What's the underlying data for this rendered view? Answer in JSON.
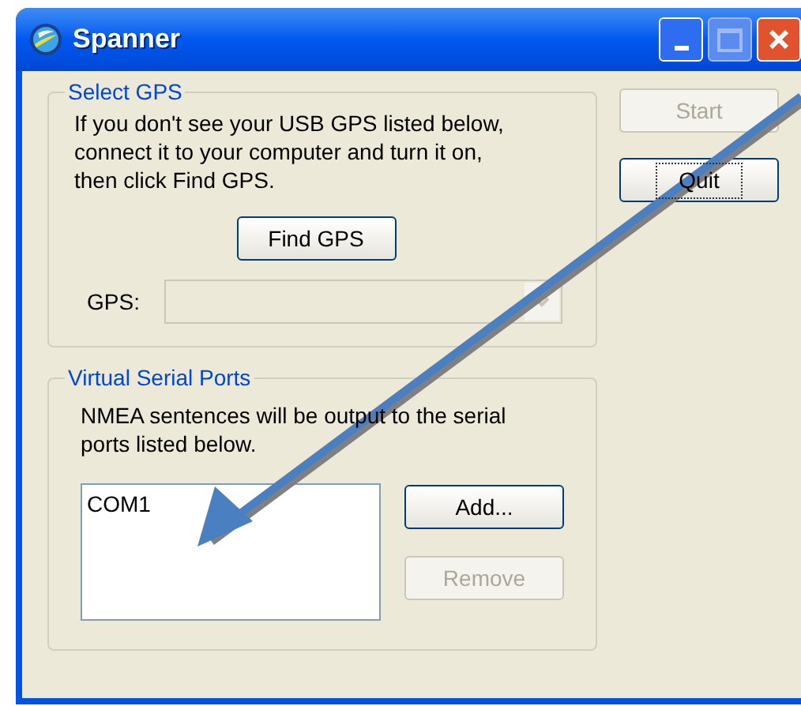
{
  "window": {
    "title": "Spanner"
  },
  "select_gps": {
    "title": "Select GPS",
    "instructions": "If you don't see your USB GPS listed below,\nconnect it to your computer and turn it on,\nthen click Find GPS.",
    "find_button": {
      "label": "Find GPS",
      "disabled": false,
      "focused": false
    },
    "gps_field": {
      "label": "GPS:",
      "disabled": true
    }
  },
  "serial_ports": {
    "title": "Virtual Serial Ports",
    "description": "NMEA sentences will be output to the serial\nports listed below.",
    "ports": [
      {
        "name": "COM1",
        "selected": false
      }
    ],
    "buttons": [
      {
        "label": "Add...",
        "disabled": false,
        "focused": false
      },
      {
        "label": "Remove",
        "disabled": true,
        "focused": false
      }
    ]
  },
  "actions": [
    {
      "label": "Start",
      "disabled": true,
      "focused": false
    },
    {
      "label": "Quit",
      "disabled": false,
      "focused": true
    }
  ]
}
